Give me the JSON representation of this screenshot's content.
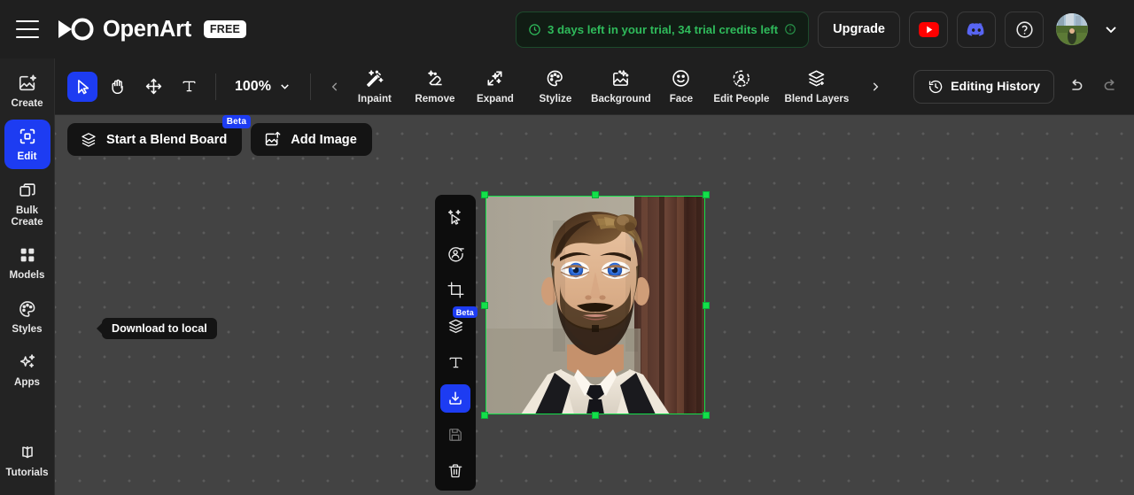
{
  "header": {
    "menu_icon": "hamburger-menu-icon",
    "logo_icon": "openart-infinity-logo-icon",
    "brand": "OpenArt",
    "plan_badge": "FREE",
    "trial": {
      "clock_icon": "clock-icon",
      "text": "3 days left in your trial,  34 trial credits left",
      "info_icon": "info-circle-icon",
      "color": "#2fbb5b"
    },
    "upgrade_label": "Upgrade",
    "youtube_icon": "youtube-icon",
    "discord_icon": "discord-icon",
    "help_icon": "help-circle-icon",
    "avatar_icon": "user-avatar",
    "account_chevron_icon": "chevron-down-icon"
  },
  "sidebar": {
    "items": [
      {
        "label": "Create",
        "icon": "image-sparkle-icon",
        "active": false
      },
      {
        "label": "Edit",
        "icon": "edit-selection-icon",
        "active": true
      },
      {
        "label": "Bulk\nCreate",
        "icon": "copy-stack-icon",
        "active": false
      },
      {
        "label": "Models",
        "icon": "grid-four-icon",
        "active": false
      },
      {
        "label": "Styles",
        "icon": "palette-icon",
        "active": false
      },
      {
        "label": "Apps",
        "icon": "sparkles-icon",
        "active": false
      }
    ],
    "bottom_item": {
      "label": "Tutorials",
      "icon": "open-book-icon"
    },
    "active_color": "#1d3cf2"
  },
  "toolbar": {
    "tools": [
      {
        "name": "select-tool",
        "icon": "cursor-arrow-icon",
        "active": true
      },
      {
        "name": "pan-tool",
        "icon": "hand-icon",
        "active": false
      },
      {
        "name": "move-tool",
        "icon": "move-arrows-icon",
        "active": false
      },
      {
        "name": "text-tool",
        "icon": "text-t-icon",
        "active": false
      }
    ],
    "zoom_level": "100%",
    "zoom_chevron_icon": "chevron-down-icon",
    "scroll_left_icon": "chevron-left-icon",
    "scroll_right_icon": "chevron-right-icon",
    "effects": [
      {
        "label": "Inpaint",
        "icon": "magic-wand-icon"
      },
      {
        "label": "Remove",
        "icon": "eraser-sparkle-icon"
      },
      {
        "label": "Expand",
        "icon": "expand-sparkle-icon"
      },
      {
        "label": "Stylize",
        "icon": "palette-icon"
      },
      {
        "label": "Background",
        "icon": "image-mountain-icon"
      },
      {
        "label": "Face",
        "icon": "smiley-face-icon"
      },
      {
        "label": "Edit People",
        "icon": "person-circle-icon"
      },
      {
        "label": "Blend Layers",
        "icon": "layers-plus-icon"
      }
    ],
    "history_label": "Editing History",
    "history_icon": "clock-rewind-icon",
    "undo_icon": "undo-arrow-icon",
    "redo_icon": "redo-arrow-icon"
  },
  "canvas": {
    "blend_board": {
      "label": "Start a Blend Board",
      "icon": "layers-icon",
      "badge": "Beta"
    },
    "add_image": {
      "label": "Add Image",
      "icon": "image-upload-icon"
    },
    "vertical_tools": [
      {
        "name": "magic-select-tool",
        "icon": "cursor-sparkle-icon",
        "active": false,
        "dim": false,
        "badge": null
      },
      {
        "name": "remove-person-tool",
        "icon": "person-minus-icon",
        "active": false,
        "dim": false,
        "badge": null
      },
      {
        "name": "crop-tool",
        "icon": "crop-icon",
        "active": false,
        "dim": false,
        "badge": null
      },
      {
        "name": "blend-layers-tool",
        "icon": "layers-icon",
        "active": false,
        "dim": false,
        "badge": "Beta"
      },
      {
        "name": "add-text-tool",
        "icon": "text-t-icon",
        "active": false,
        "dim": false,
        "badge": null
      },
      {
        "name": "download-tool",
        "icon": "download-icon",
        "active": true,
        "dim": false,
        "badge": null
      },
      {
        "name": "save-tool",
        "icon": "floppy-save-icon",
        "active": false,
        "dim": true,
        "badge": null
      },
      {
        "name": "delete-tool",
        "icon": "trash-icon",
        "active": false,
        "dim": false,
        "badge": null
      }
    ],
    "tooltip": "Download to local",
    "selection": {
      "color": "#13e04a",
      "subject": "portrait of a bearded man with blue eyes in a white shirt, black vest and tie"
    }
  }
}
